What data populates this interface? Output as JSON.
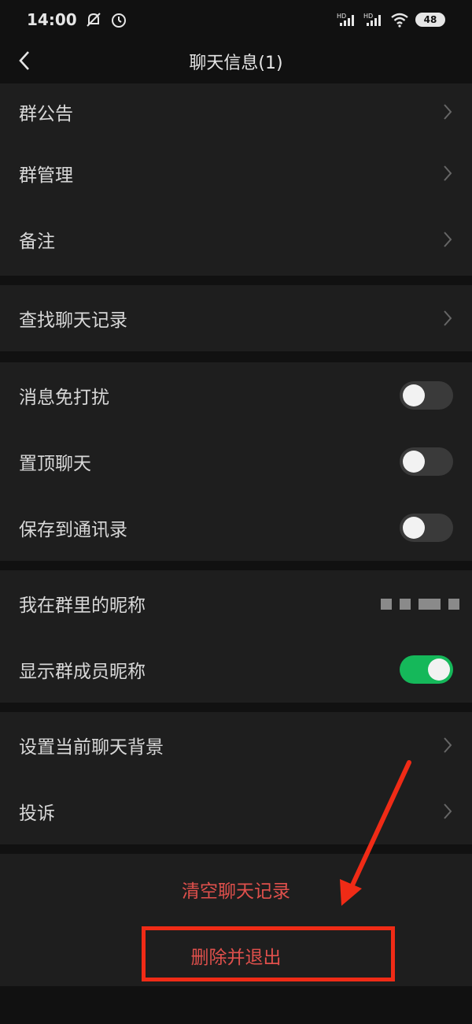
{
  "status_bar": {
    "time": "14:00",
    "battery": "48",
    "icons": [
      "mute-bell-icon",
      "alarm-icon",
      "signal-hd-icon",
      "signal-hd-icon",
      "wifi-icon"
    ]
  },
  "nav": {
    "title": "聊天信息(1)"
  },
  "group1": {
    "items": [
      {
        "label": "群公告"
      },
      {
        "label": "群管理"
      },
      {
        "label": "备注"
      }
    ]
  },
  "group2": {
    "items": [
      {
        "label": "查找聊天记录"
      }
    ]
  },
  "group3": {
    "items": [
      {
        "label": "消息免打扰",
        "on": false
      },
      {
        "label": "置顶聊天",
        "on": false
      },
      {
        "label": "保存到通讯录",
        "on": false
      }
    ]
  },
  "group4": {
    "nickname_label": "我在群里的昵称",
    "show_member_nickname_label": "显示群成员昵称",
    "show_member_nickname_on": true
  },
  "group5": {
    "items": [
      {
        "label": "设置当前聊天背景"
      },
      {
        "label": "投诉"
      }
    ]
  },
  "actions": {
    "clear_history": "清空聊天记录",
    "delete_and_exit": "删除并退出"
  },
  "colors": {
    "accent_red": "#e0504c",
    "toggle_on": "#15b85a",
    "annotation": "#f02b16"
  }
}
